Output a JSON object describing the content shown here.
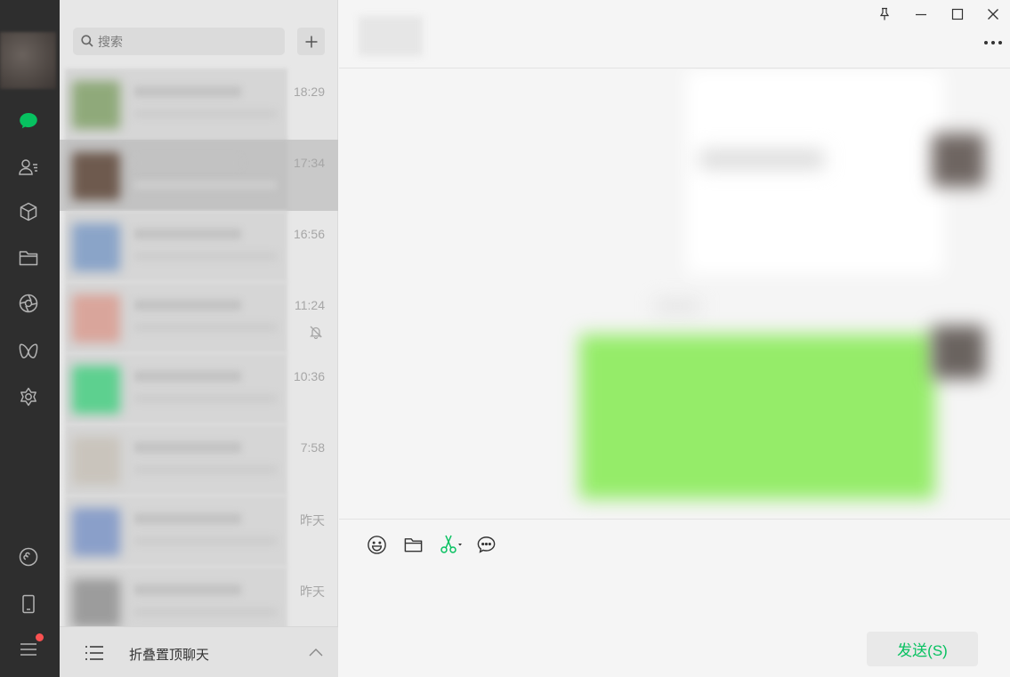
{
  "search": {
    "placeholder": "搜索"
  },
  "chat_list": {
    "items": [
      {
        "time": "18:29",
        "muted": false,
        "selected": false,
        "avatar_color": "#8fa97a"
      },
      {
        "time": "17:34",
        "muted": false,
        "selected": true,
        "avatar_color": "#6e5a4e"
      },
      {
        "time": "16:56",
        "muted": false,
        "selected": false,
        "avatar_color": "#8aa4c8"
      },
      {
        "time": "11:24",
        "muted": true,
        "selected": false,
        "avatar_color": "#d9a59b"
      },
      {
        "time": "10:36",
        "muted": false,
        "selected": false,
        "avatar_color": "#5dd08f"
      },
      {
        "time": "7:58",
        "muted": false,
        "selected": false,
        "avatar_color": "#c9c4bc"
      },
      {
        "time": "昨天",
        "muted": false,
        "selected": false,
        "avatar_color": "#8a9fc9"
      },
      {
        "time": "昨天",
        "muted": false,
        "selected": false,
        "avatar_color": "#9c9c9c"
      }
    ],
    "fold_label": "折叠置顶聊天"
  },
  "composer": {
    "send_label": "发送(S)"
  },
  "colors": {
    "accent": "#07c160",
    "sidebar": "#2e2e2e",
    "bubble_self": "#95ec69",
    "badge": "#fa5151"
  }
}
